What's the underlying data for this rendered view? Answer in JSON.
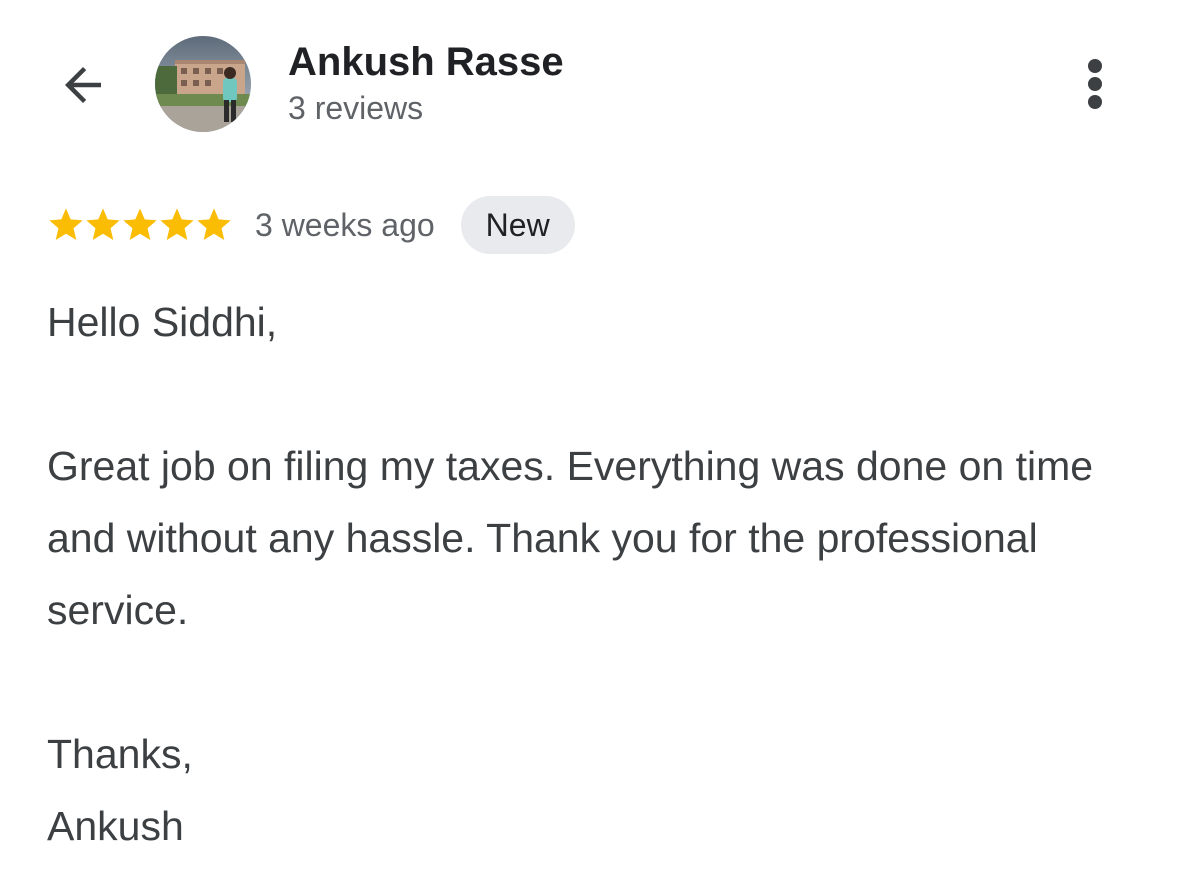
{
  "header": {
    "back_icon": "arrow-left-icon",
    "avatar_icon": "profile-photo",
    "user_name": "Ankush Rasse",
    "review_count": "3 reviews",
    "more_icon": "more-vert-icon"
  },
  "review": {
    "rating": 5,
    "max_rating": 5,
    "star_icon": "star-icon",
    "star_color": "#fbbc04",
    "timestamp": "3 weeks ago",
    "badge": "New",
    "lines": {
      "greeting": "Hello Siddhi,",
      "body": "Great job on filing my taxes. Everything was done on time and without any hassle. Thank you for the professional service.",
      "closing": "Thanks,",
      "signature": "Ankush"
    }
  },
  "colors": {
    "primary_text": "#202124",
    "secondary_text": "#5f6368",
    "body_text": "#3c4043",
    "badge_bg": "#e8eaed"
  }
}
